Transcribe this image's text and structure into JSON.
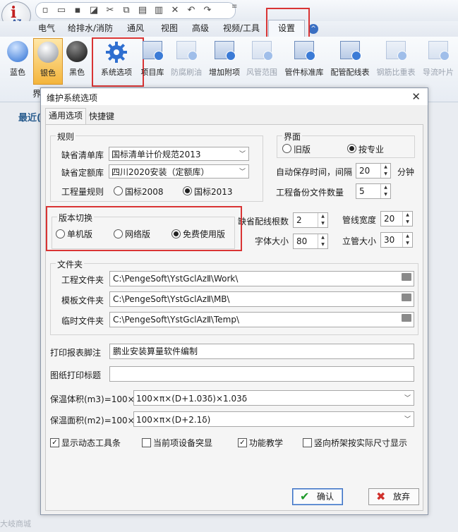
{
  "quick_access": {
    "icons": [
      "new-icon",
      "open-icon",
      "save-icon",
      "save-as-icon",
      "cut-icon",
      "copy-icon",
      "paste-icon",
      "paste-special-icon",
      "delete-icon",
      "undo-icon",
      "redo-icon"
    ]
  },
  "tabs": [
    {
      "label": "电气"
    },
    {
      "label": "给排水/消防"
    },
    {
      "label": "通风"
    },
    {
      "label": "视图"
    },
    {
      "label": "高级"
    },
    {
      "label": "视频/工具"
    },
    {
      "label": "设置"
    }
  ],
  "ribbon": {
    "items": [
      {
        "label": "蓝色"
      },
      {
        "label": "银色"
      },
      {
        "label": "黑色"
      },
      {
        "label": "系统选项"
      },
      {
        "label": "项目库"
      },
      {
        "label": "防腐刷油"
      },
      {
        "label": "增加附项"
      },
      {
        "label": "风管范围"
      },
      {
        "label": "管件标准库"
      },
      {
        "label": "配管配线表"
      },
      {
        "label": "钢筋比重表"
      },
      {
        "label": "导流叶片"
      }
    ],
    "group_label": "界",
    "recent": "最近("
  },
  "dialog": {
    "title": "维护系统选项",
    "tabs": [
      "通用选项",
      "快捷键"
    ],
    "rules": {
      "title": "规则",
      "default_list_label": "缺省清单库",
      "default_list_value": "国标清单计价规范2013",
      "default_quota_label": "缺省定额库",
      "default_quota_value": "四川2020安装（定额库）",
      "qty_rule_label": "工程量规则",
      "opt_2008": "国标2008",
      "opt_2013": "国标2013"
    },
    "ui": {
      "title": "界面",
      "opt_old": "旧版",
      "opt_profession": "按专业"
    },
    "autosave_label": "自动保存时间，间隔",
    "autosave_value": "20",
    "autosave_unit": "分钟",
    "backup_label": "工程备份文件数量",
    "backup_value": "5",
    "version": {
      "title": "版本切换",
      "opt_single": "单机版",
      "opt_network": "网络版",
      "opt_free": "免费使用版"
    },
    "default_wire_label": "缺省配线根数",
    "default_wire_value": "2",
    "pipe_width_label": "管线宽度",
    "pipe_width_value": "20",
    "font_size_label": "字体大小",
    "font_size_value": "80",
    "riser_size_label": "立管大小",
    "riser_size_value": "30",
    "folders": {
      "title": "文件夹",
      "project_label": "工程文件夹",
      "project_value": "C:\\PengeSoft\\YstGclAzⅡ\\Work\\",
      "template_label": "模板文件夹",
      "template_value": "C:\\PengeSoft\\YstGclAzⅡ\\MB\\",
      "temp_label": "临时文件夹",
      "temp_value": "C:\\PengeSoft\\YstGclAzⅡ\\Temp\\"
    },
    "print_footer_label": "打印报表脚注",
    "print_footer_value": "鹏业安装算量软件编制",
    "drawing_title_label": "图纸打印标题",
    "drawing_title_value": "",
    "insul_volume_label": "保温体积(m3)=100×",
    "insul_volume_value": "100×π×(D+1.03δ)×1.03δ",
    "insul_area_label": "保温面积(m2)=100×",
    "insul_area_value": "100×π×(D+2.1δ)",
    "checks": [
      "显示动态工具条",
      "当前项设备突显",
      "功能教学",
      "竖向桥架按实际尺寸显示"
    ],
    "ok": "确认",
    "cancel": "放弃"
  },
  "watermark": "大岐商城"
}
